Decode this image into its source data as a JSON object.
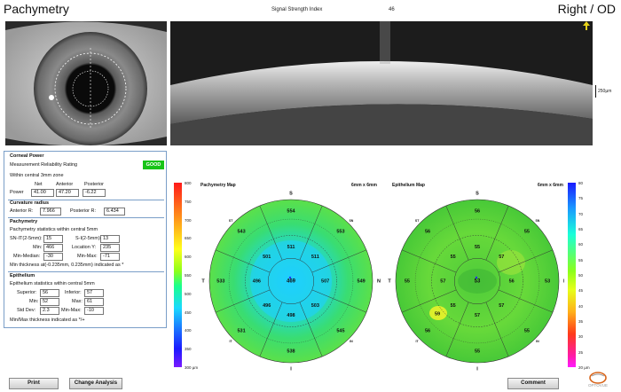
{
  "header": {
    "title": "Pachymetry",
    "signal_label": "Signal Strength Index",
    "signal_value": "46",
    "eye": "Right / OD"
  },
  "oct": {
    "scale_label": "250µm"
  },
  "corneal_power": {
    "title": "Corneal Power",
    "reliability_label": "Measurement Reliability Rating",
    "reliability_value": "GOOD",
    "zone_label": "Within central 3mm zone",
    "col_net": "Net",
    "col_anterior": "Anterior",
    "col_posterior": "Posterior",
    "power_label": "Power",
    "net": "41.00",
    "anterior": "47.20",
    "posterior": "-6.22"
  },
  "curvature": {
    "title": "Curvature radius",
    "anterior_label": "Anterior R:",
    "anterior_value": "7.966",
    "posterior_label": "Posterior R:",
    "posterior_value": "6.434"
  },
  "pachymetry": {
    "title": "Pachymetry",
    "subtitle": "Pachymetry statistics within central 5mm",
    "sn_it_label": "SN-IT(2-5mm):",
    "sn_it_value": "15",
    "s_i_label": "S-I(2-5mm):",
    "s_i_value": "13",
    "min_label": "Min:",
    "min_value": "466",
    "location_label": "Location Y:",
    "location_value": "235",
    "min_median_label": "Min-Median:",
    "min_median_value": "-30",
    "min_max_label": "Min-Max:",
    "min_max_value": "-71",
    "note": "Min thickness at(-0.235mm, 0.235mm) indicated as *"
  },
  "epithelium": {
    "title": "Epithelium",
    "subtitle": "Epithelium statistics within central 5mm",
    "superior_label": "Superior:",
    "superior_value": "56",
    "inferior_label": "Inferior:",
    "inferior_value": "57",
    "min_label": "Min:",
    "min_value": "52",
    "max_label": "Max:",
    "max_value": "61",
    "std_label": "Std Dev:",
    "std_value": "2.3",
    "min_max_label": "Min-Max:",
    "min_max_value": "-10",
    "note": "Min/Max thickness indicated as */+"
  },
  "buttons": {
    "print": "Print",
    "change_analysis": "Change Analysis",
    "comment": "Comment"
  },
  "pachy_map": {
    "title": "Pachymetry Map",
    "size": "6mm x 6mm",
    "scale_ticks": [
      "800",
      "750",
      "700",
      "650",
      "600",
      "550",
      "500",
      "450",
      "400",
      "350",
      "300 µm"
    ],
    "center": "469",
    "inner": {
      "S": "511",
      "SN": "511",
      "N": "507",
      "IN": "503",
      "I": "498",
      "IT": "496",
      "T": "496",
      "ST": "501"
    },
    "outer": {
      "S": "554",
      "SN": "553",
      "N": "549",
      "IN": "545",
      "I": "538",
      "IT": "531",
      "T": "533",
      "ST": "543"
    },
    "dirs": {
      "S": "S",
      "N": "N",
      "I": "I",
      "T": "T",
      "ST": "ST",
      "SN": "SN",
      "IT": "IT",
      "IN": "IN"
    }
  },
  "epi_map": {
    "title": "Epithelium Map",
    "size": "6mm x 6mm",
    "scale_ticks": [
      "80",
      "75",
      "70",
      "65",
      "60",
      "55",
      "50",
      "45",
      "40",
      "35",
      "30",
      "25",
      "20 µm"
    ],
    "center": "53",
    "inner": {
      "S": "55",
      "SN": "57",
      "N": "56",
      "IN": "57",
      "I": "57",
      "IT": "55",
      "T": "57",
      "ST": "55"
    },
    "outer": {
      "S": "56",
      "SN": "55",
      "N": "53",
      "IN": "55",
      "I": "55",
      "IT": "56",
      "T": "55",
      "ST": "56"
    },
    "min_marker": "59",
    "dirs": {
      "S": "S",
      "N": "N",
      "I": "I",
      "T": "T",
      "ST": "ST",
      "SN": "SN",
      "IT": "IT",
      "IN": "IN"
    }
  },
  "logo": "OPTOVUE",
  "colors": {
    "good": "#17c417",
    "panel_border": "#7a9ec8",
    "pachy_base": "#2fd46b",
    "epi_base": "#4fd136"
  }
}
